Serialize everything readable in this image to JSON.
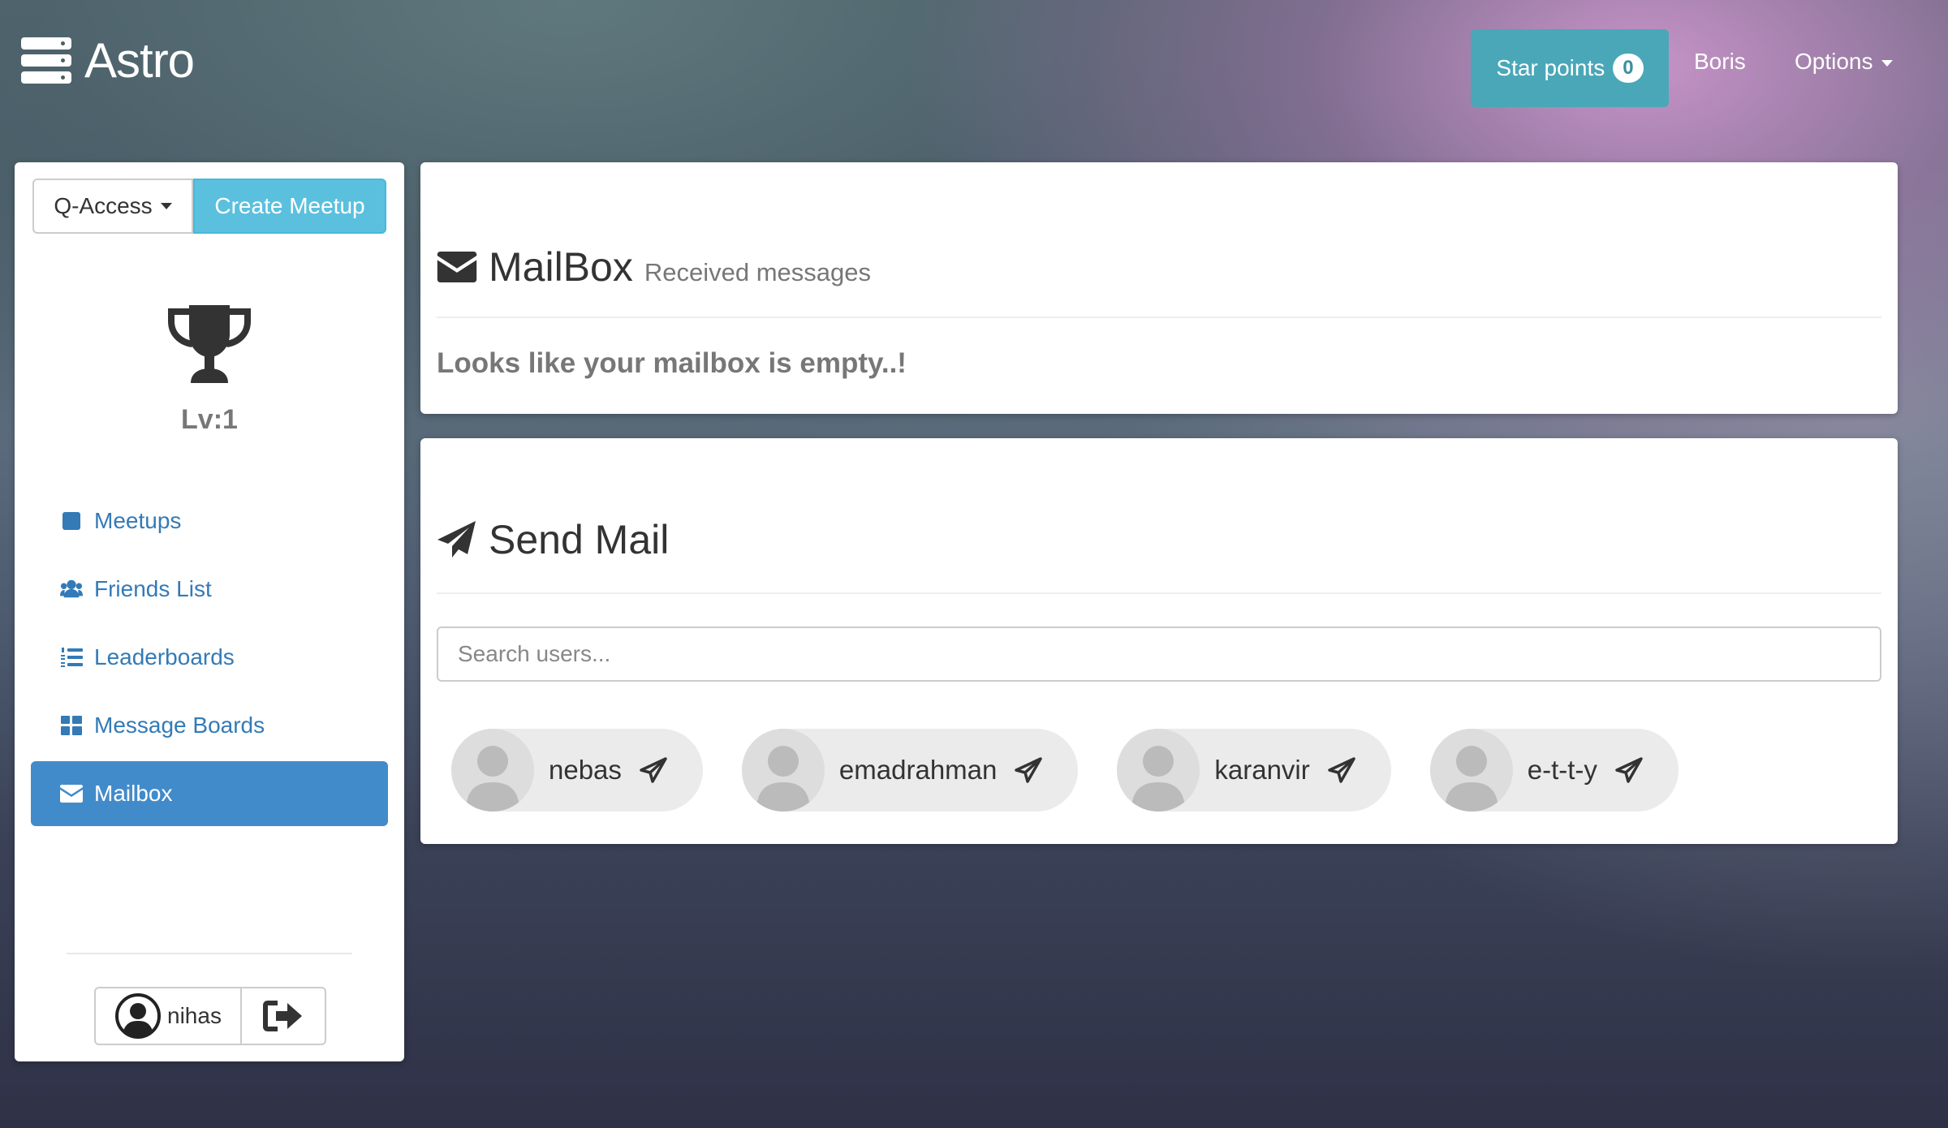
{
  "navbar": {
    "brand": "Astro",
    "star_points_label": "Star points",
    "star_points_count": "0",
    "user_link": "Boris",
    "options_label": "Options"
  },
  "sidebar": {
    "qaccess_label": "Q-Access",
    "create_meetup_label": "Create Meetup",
    "level": "Lv:1",
    "items": [
      {
        "label": "Meetups",
        "icon": "square-icon"
      },
      {
        "label": "Friends List",
        "icon": "users-icon"
      },
      {
        "label": "Leaderboards",
        "icon": "list-ol-icon"
      },
      {
        "label": "Message Boards",
        "icon": "grid-icon"
      },
      {
        "label": "Mailbox",
        "icon": "envelope-icon",
        "active": true
      }
    ],
    "username": "nihas"
  },
  "mailbox": {
    "title": "MailBox",
    "subtitle": "Received messages",
    "empty_message": "Looks like your mailbox is empty..!"
  },
  "send_mail": {
    "title": "Send Mail",
    "search_placeholder": "Search users...",
    "users": [
      "nebas",
      "emadrahman",
      "karanvir",
      "e-t-t-y"
    ]
  },
  "colors": {
    "star_button": "#49a7b8",
    "create_meetup": "#5bc0de",
    "active_nav": "#428bca",
    "link": "#337ab7"
  }
}
